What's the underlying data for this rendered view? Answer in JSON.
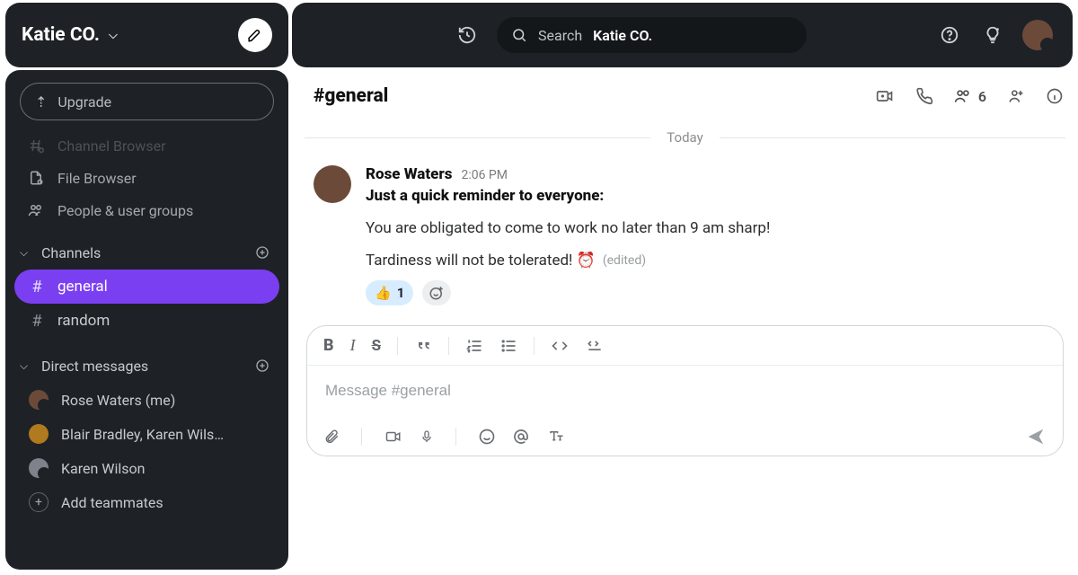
{
  "workspace": {
    "name": "Katie CO."
  },
  "sidebar": {
    "upgrade": "Upgrade",
    "nav": [
      {
        "label": "Channel Browser"
      },
      {
        "label": "File Browser"
      },
      {
        "label": "People & user groups"
      }
    ],
    "sections": {
      "channels": {
        "title": "Channels",
        "items": [
          {
            "label": "general",
            "active": true
          },
          {
            "label": "random"
          }
        ]
      },
      "dms": {
        "title": "Direct messages",
        "items": [
          {
            "label": "Rose Waters (me)"
          },
          {
            "label": "Blair Bradley, Karen Wils…"
          },
          {
            "label": "Karen Wilson"
          }
        ],
        "add": "Add teammates"
      }
    }
  },
  "topbar": {
    "search_label": "Search",
    "search_context": "Katie CO."
  },
  "channel": {
    "name": "#general",
    "member_count": "6"
  },
  "divider": "Today",
  "message": {
    "user": "Rose Waters",
    "time": "2:06 PM",
    "lead": "Just a quick reminder to everyone:",
    "line2": "You are obligated to come to work no later than 9 am sharp!",
    "line3": "Tardiness will not be tolerated! ⏰",
    "edited": "(edited)",
    "reaction": {
      "emoji": "👍",
      "count": "1"
    }
  },
  "composer": {
    "placeholder": "Message #general"
  }
}
